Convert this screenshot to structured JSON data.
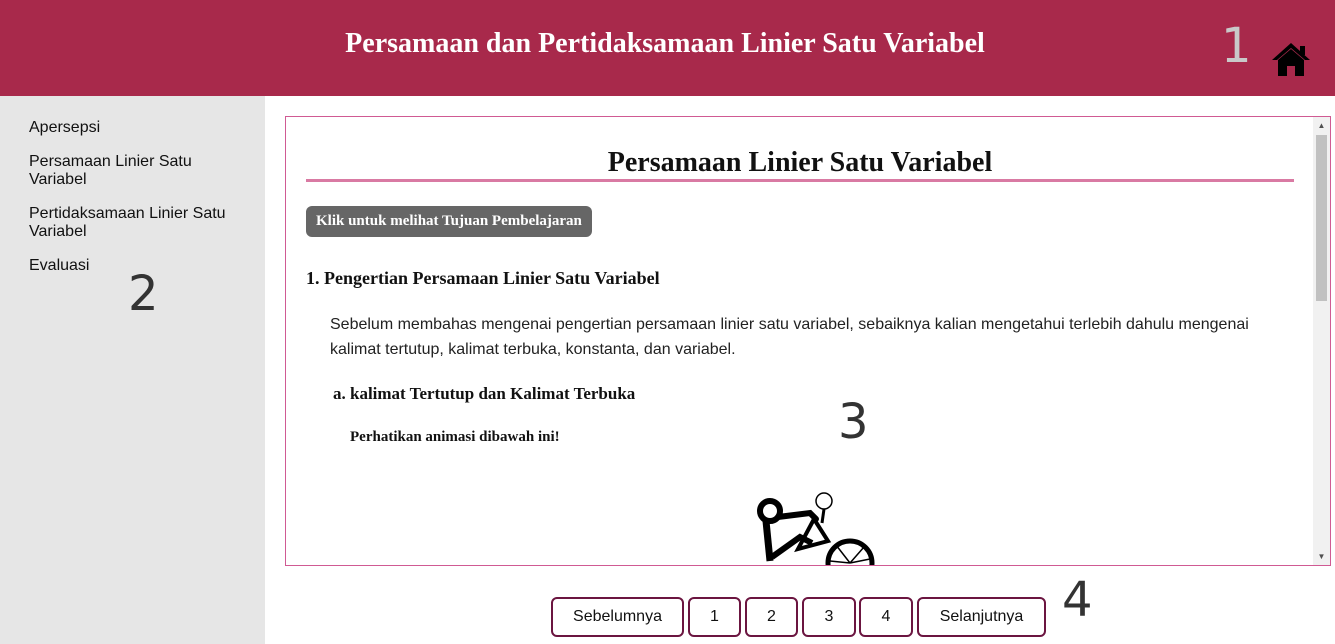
{
  "header": {
    "title": "Persamaan dan Pertidaksamaan Linier Satu Variabel",
    "marker": "1",
    "home_icon": "home-icon",
    "background_color": "#a8294b"
  },
  "sidebar": {
    "items": [
      {
        "label": "Apersepsi"
      },
      {
        "label": "Persamaan Linier Satu Variabel"
      },
      {
        "label": "Pertidaksamaan Linier Satu Variabel"
      },
      {
        "label": "Evaluasi"
      }
    ],
    "marker": "2"
  },
  "content": {
    "heading": "Persamaan Linier Satu Variabel",
    "goal_button": "Klik untuk melihat Tujuan Pembelajaran",
    "section_title": "1. Pengertian Persamaan Linier Satu Variabel",
    "paragraph": "Sebelum membahas mengenai pengertian persamaan linier satu variabel, sebaiknya kalian mengetahui terlebih dahulu mengenai kalimat tertutup, kalimat terbuka, konstanta, dan variabel.",
    "subsection_title": "a. kalimat Tertutup dan Kalimat Terbuka",
    "note": "Perhatikan animasi dibawah ini!",
    "marker": "3",
    "border_color": "#d05a93"
  },
  "pager": {
    "prev": "Sebelumnya",
    "pages": [
      "1",
      "2",
      "3",
      "4"
    ],
    "next": "Selanjutnya",
    "marker": "4"
  }
}
